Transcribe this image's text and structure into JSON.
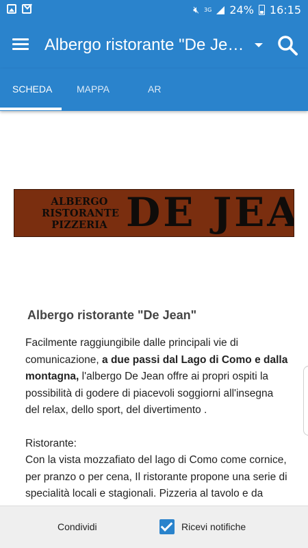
{
  "status_bar": {
    "battery": "24%",
    "time": "16:15",
    "network": "3G",
    "icons": [
      "image-icon",
      "mail-icon",
      "mute-icon",
      "signal-icon",
      "battery-icon"
    ]
  },
  "toolbar": {
    "title": "Albergo ristorante \"De Jean\"",
    "icons": [
      "menu-icon",
      "dropdown-icon",
      "search-icon"
    ],
    "color": "#2a83cc"
  },
  "tabs": [
    {
      "label": "SCHEDA",
      "active": true
    },
    {
      "label": "MAPPA",
      "active": false
    },
    {
      "label": "AR",
      "active": false
    }
  ],
  "banner": {
    "left_lines": [
      "ALBERGO",
      "RISTORANTE",
      "PIZZERIA"
    ],
    "right_text": "DE JEAN",
    "color": "#7a2e0f"
  },
  "article": {
    "heading": "Albergo ristorante \"De Jean\"",
    "p1_pre": "Facilmente raggiungibile dalle principali vie di comunicazione, ",
    "p1_bold": "a due passi dal Lago di Como e dalla montagna,",
    "p1_post": " l'albergo De Jean offre ai propri ospiti la possibilità di godere di piacevoli soggiorni all'insegna del relax, dello sport, del divertimento .",
    "p2_title": "Ristorante:",
    "p2_text": "Con la vista mozzafiato del lago di Como come cornice, per pranzo o per cena, Il ristorante propone una serie di specialità locali e stagionali. Pizzeria al tavolo e da asporto."
  },
  "bottom_bar": {
    "share_label": "Condividi",
    "notifications_label": "Ricevi notifiche",
    "notifications_checked": true
  }
}
